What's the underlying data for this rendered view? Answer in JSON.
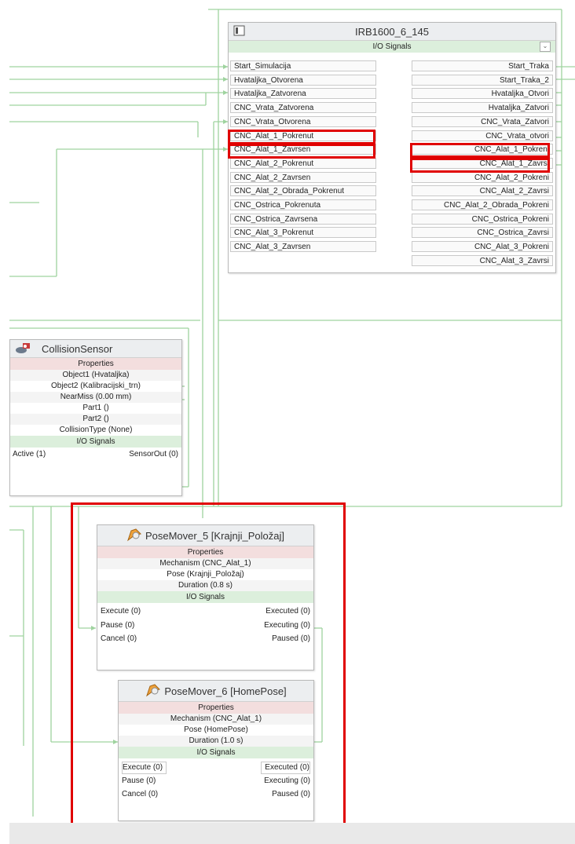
{
  "irb": {
    "title": "IRB1600_6_145",
    "io_label": "I/O Signals",
    "inputs": [
      "Start_Simulacija",
      "Hvataljka_Otvorena",
      "Hvataljka_Zatvorena",
      "CNC_Vrata_Zatvorena",
      "CNC_Vrata_Otvorena",
      "CNC_Alat_1_Pokrenut",
      "CNC_Alat_1_Zavrsen",
      "CNC_Alat_2_Pokrenut",
      "CNC_Alat_2_Zavrsen",
      "CNC_Alat_2_Obrada_Pokrenut",
      "CNC_Ostrica_Pokrenuta",
      "CNC_Ostrica_Zavrsena",
      "CNC_Alat_3_Pokrenut",
      "CNC_Alat_3_Zavrsen"
    ],
    "outputs": [
      "Start_Traka",
      "Start_Traka_2",
      "Hvataljka_Otvori",
      "Hvataljka_Zatvori",
      "CNC_Vrata_Zatvori",
      "CNC_Vrata_otvori",
      "CNC_Alat_1_Pokreni",
      "CNC_Alat_1_Zavrsi",
      "CNC_Alat_2_Pokreni",
      "CNC_Alat_2_Zavrsi",
      "CNC_Alat_2_Obrada_Pokreni",
      "CNC_Ostrica_Pokreni",
      "CNC_Ostrica_Zavrsi",
      "CNC_Alat_3_Pokreni",
      "CNC_Alat_3_Zavrsi"
    ]
  },
  "collision": {
    "title": "CollisionSensor",
    "props_label": "Properties",
    "props": [
      "Object1 (Hvataljka)",
      "Object2 (Kalibracijski_trn)",
      "NearMiss (0.00 mm)",
      "Part1 ()",
      "Part2 ()",
      "CollisionType (None)"
    ],
    "io_label": "I/O Signals",
    "in_signal": "Active (1)",
    "out_signal": "SensorOut (0)"
  },
  "pm5": {
    "title": "PoseMover_5 [Krajnji_Položaj]",
    "props_label": "Properties",
    "props": [
      "Mechanism (CNC_Alat_1)",
      "Pose (Krajnji_Položaj)",
      "Duration (0.8 s)"
    ],
    "io_label": "I/O Signals",
    "inputs": [
      "Execute (0)",
      "Pause (0)",
      "Cancel (0)"
    ],
    "outputs": [
      "Executed (0)",
      "Executing (0)",
      "Paused (0)"
    ]
  },
  "pm6": {
    "title": "PoseMover_6 [HomePose]",
    "props_label": "Properties",
    "props": [
      "Mechanism (CNC_Alat_1)",
      "Pose (HomePose)",
      "Duration (1.0 s)"
    ],
    "io_label": "I/O Signals",
    "inputs": [
      "Execute (0)",
      "Pause (0)",
      "Cancel (0)"
    ],
    "outputs": [
      "Executed (0)",
      "Executing (0)",
      "Paused (0)"
    ]
  },
  "colors": {
    "wire": "#9fd39f",
    "highlight": "#e00000",
    "props_bg": "#f3dede",
    "io_bg": "#dcefdc"
  },
  "icons": {
    "irb": "robot-controller-icon",
    "collision": "collision-sensor-icon",
    "posemover": "posemover-icon",
    "dropdown": "chevron-down-icon"
  }
}
